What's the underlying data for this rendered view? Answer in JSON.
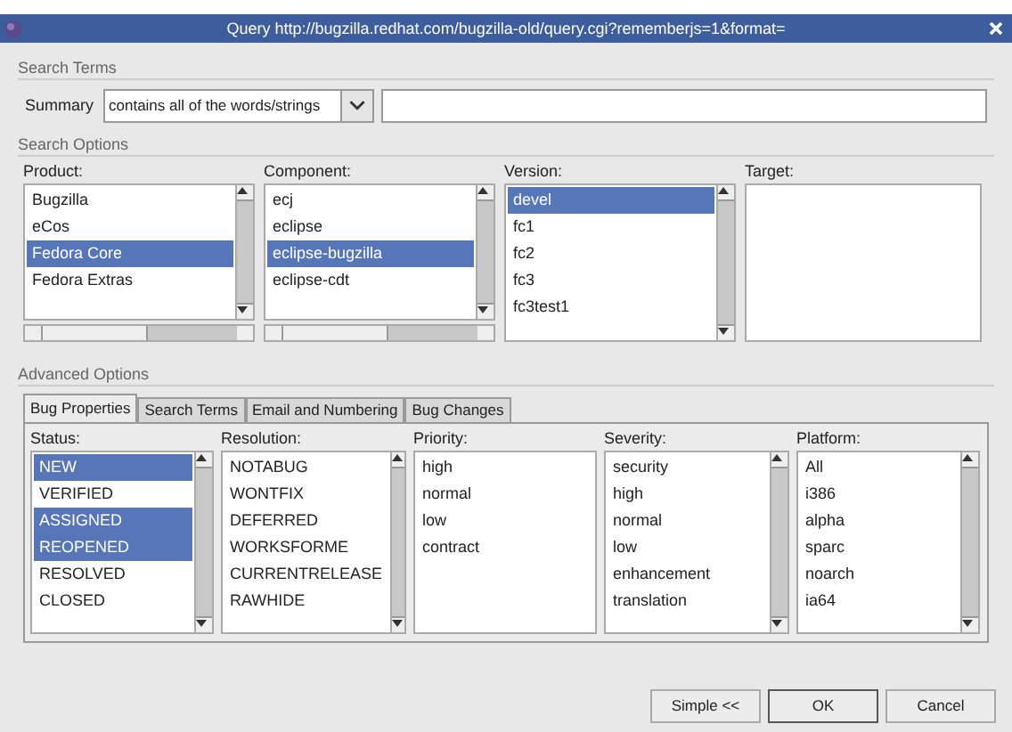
{
  "window": {
    "title": "Query http://bugzilla.redhat.com/bugzilla-old/query.cgi?rememberjs=1&format="
  },
  "search_terms": {
    "title": "Search Terms",
    "label": "Summary",
    "operator": "contains all of the words/strings"
  },
  "search_options": {
    "title": "Search Options",
    "lists": [
      {
        "label": "Product:",
        "kind": "scrolled_both",
        "items": [
          {
            "text": "Bugzilla",
            "selected": false
          },
          {
            "text": "eCos",
            "selected": false
          },
          {
            "text": "Fedora Core",
            "selected": true
          },
          {
            "text": "Fedora Extras",
            "selected": false
          }
        ]
      },
      {
        "label": "Component:",
        "kind": "scrolled_both",
        "items": [
          {
            "text": "ecj",
            "selected": false
          },
          {
            "text": "eclipse",
            "selected": false
          },
          {
            "text": "eclipse-bugzilla",
            "selected": true
          },
          {
            "text": "eclipse-cdt",
            "selected": false
          }
        ]
      },
      {
        "label": "Version:",
        "kind": "scrolled",
        "items": [
          {
            "text": "devel",
            "selected": true
          },
          {
            "text": "fc1",
            "selected": false
          },
          {
            "text": "fc2",
            "selected": false
          },
          {
            "text": "fc3",
            "selected": false
          },
          {
            "text": "fc3test1",
            "selected": false
          }
        ]
      },
      {
        "label": "Target:",
        "kind": "plain"
      }
    ]
  },
  "advanced_options": {
    "title": "Advanced Options",
    "tabs": [
      {
        "label": "Bug Properties",
        "selected": true
      },
      {
        "label": "Search Terms",
        "selected": false
      },
      {
        "label": "Email and Numbering",
        "selected": false
      },
      {
        "label": "Bug Changes",
        "selected": false
      }
    ],
    "lists": [
      {
        "label": "Status:",
        "kind": "scrolled",
        "items": [
          {
            "text": "NEW",
            "selected": true
          },
          {
            "text": "VERIFIED",
            "selected": false
          },
          {
            "text": "ASSIGNED",
            "selected": true
          },
          {
            "text": "REOPENED",
            "selected": true
          },
          {
            "text": "RESOLVED",
            "selected": false
          },
          {
            "text": "CLOSED",
            "selected": false
          }
        ]
      },
      {
        "label": "Resolution:",
        "kind": "scrolled",
        "items": [
          {
            "text": "NOTABUG",
            "selected": false
          },
          {
            "text": "WONTFIX",
            "selected": false
          },
          {
            "text": "DEFERRED",
            "selected": false
          },
          {
            "text": "WORKSFORME",
            "selected": false
          },
          {
            "text": "CURRENTRELEASE",
            "selected": false
          },
          {
            "text": "RAWHIDE",
            "selected": false
          }
        ]
      },
      {
        "label": "Priority:",
        "kind": "plain",
        "items": [
          {
            "text": "high",
            "selected": false
          },
          {
            "text": "normal",
            "selected": false
          },
          {
            "text": "low",
            "selected": false
          },
          {
            "text": "contract",
            "selected": false
          }
        ]
      },
      {
        "label": "Severity:",
        "kind": "scrolled",
        "items": [
          {
            "text": "security",
            "selected": false
          },
          {
            "text": "high",
            "selected": false
          },
          {
            "text": "normal",
            "selected": false
          },
          {
            "text": "low",
            "selected": false
          },
          {
            "text": "enhancement",
            "selected": false
          },
          {
            "text": "translation",
            "selected": false
          }
        ]
      },
      {
        "label": "Platform:",
        "kind": "scrolled",
        "items": [
          {
            "text": "All",
            "selected": false
          },
          {
            "text": "i386",
            "selected": false
          },
          {
            "text": "alpha",
            "selected": false
          },
          {
            "text": "sparc",
            "selected": false
          },
          {
            "text": "noarch",
            "selected": false
          },
          {
            "text": "ia64",
            "selected": false
          }
        ]
      }
    ]
  },
  "buttons": [
    {
      "label": "Simple <<"
    },
    {
      "label": "OK"
    },
    {
      "label": "Cancel"
    }
  ]
}
